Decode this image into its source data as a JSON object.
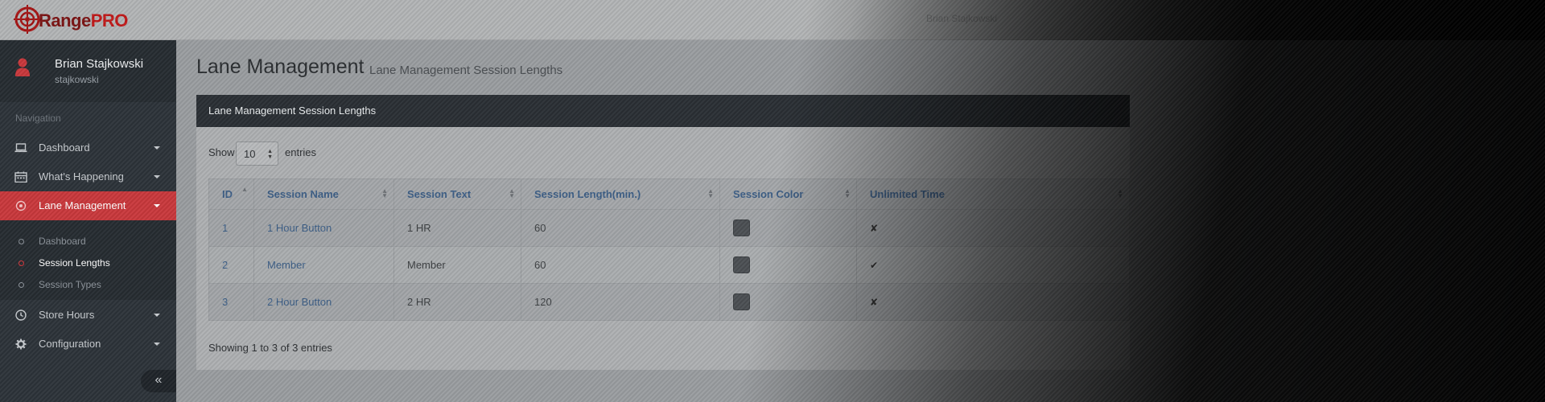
{
  "app": {
    "logo_text_a": "Range",
    "logo_text_b": "PRO",
    "header_user": "Brian Stajkowski"
  },
  "profile": {
    "name": "Brian Stajkowski",
    "username": "stajkowski"
  },
  "sidebar": {
    "nav_header": "Navigation",
    "items": [
      {
        "label": "Dashboard",
        "icon": "laptop-icon"
      },
      {
        "label": "What's Happening",
        "icon": "calendar-icon"
      },
      {
        "label": "Lane Management",
        "icon": "target-icon",
        "active": true
      },
      {
        "label": "Store Hours",
        "icon": "clock-icon"
      },
      {
        "label": "Configuration",
        "icon": "gear-icon"
      }
    ],
    "subitems": [
      {
        "label": "Dashboard"
      },
      {
        "label": "Session Lengths",
        "current": true
      },
      {
        "label": "Session Types"
      }
    ],
    "collapse_label": "«"
  },
  "page": {
    "title": "Lane Management",
    "subtitle": "Lane Management Session Lengths"
  },
  "panel": {
    "heading": "Lane Management Session Lengths",
    "show_label": "Show",
    "entries_value": "10",
    "entries_label": "entries",
    "info": "Showing 1 to 3 of 3 entries"
  },
  "table": {
    "columns": [
      "ID",
      "Session Name",
      "Session Text",
      "Session Length(min.)",
      "Session Color",
      "Unlimited Time"
    ],
    "rows": [
      {
        "id": "1",
        "name": "1 Hour Button",
        "text": "1 HR",
        "length": "60",
        "color": "#4b4f53",
        "unlimited": "✘"
      },
      {
        "id": "2",
        "name": "Member",
        "text": "Member",
        "length": "60",
        "color": "#4b4f53",
        "unlimited": "✔"
      },
      {
        "id": "3",
        "name": "2 Hour Button",
        "text": "2 HR",
        "length": "120",
        "color": "#4b4f53",
        "unlimited": "✘"
      }
    ]
  },
  "colors": {
    "accent": "#c9383c",
    "sidebar": "#2d3339",
    "link": "#3c5e86"
  }
}
